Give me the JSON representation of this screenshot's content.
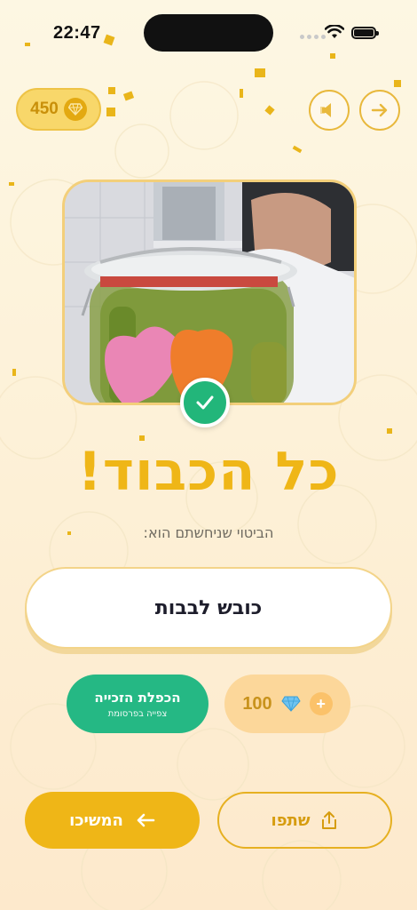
{
  "status_bar": {
    "time": "22:47"
  },
  "top_bar": {
    "gem_count": "450",
    "sound_icon": "speaker-icon",
    "next_icon": "arrow-right-icon"
  },
  "photo": {
    "subject": "pickle-jar-photo",
    "check_icon": "checkmark-icon"
  },
  "result": {
    "headline": "כל הכבוד!",
    "subtitle": "הביטוי שניחשתם הוא:",
    "answer": "כובש לבבות"
  },
  "reward": {
    "double_title": "הכפלת הזכייה",
    "double_subtitle": "צפייה בפרסומת",
    "buy_amount": "100",
    "buy_icon": "diamond-icon",
    "plus_symbol": "+"
  },
  "actions": {
    "continue_label": "המשיכו",
    "share_label": "שתפו"
  },
  "colors": {
    "accent": "#efb617",
    "success": "#25b884",
    "background": "#fdf7e3"
  }
}
